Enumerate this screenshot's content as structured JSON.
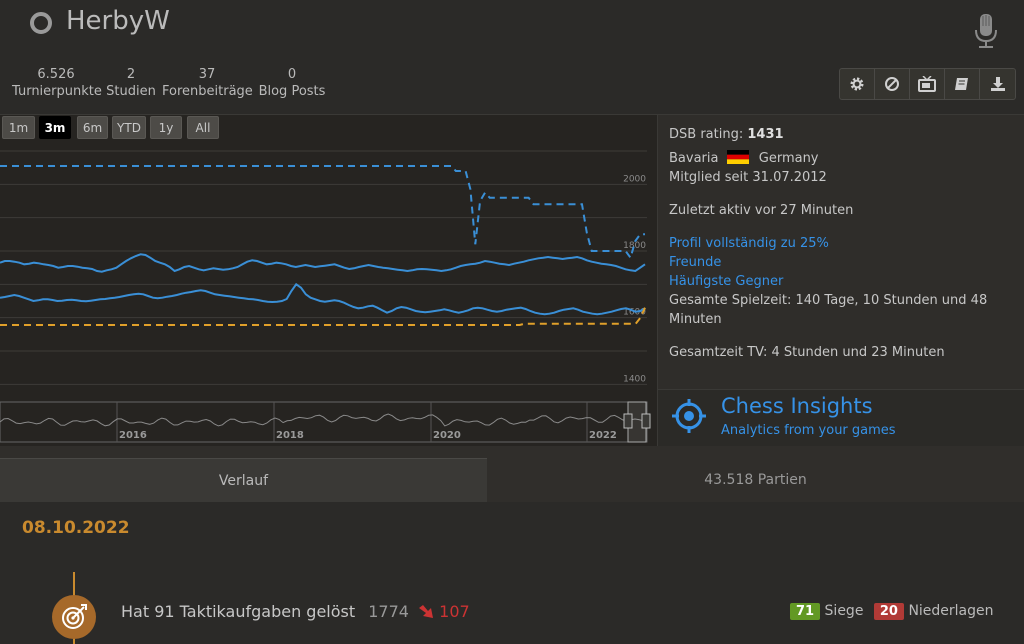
{
  "user": {
    "name": "HerbyW"
  },
  "stats": [
    {
      "value": "6.526",
      "label": "Turnierpunkte"
    },
    {
      "value": "2",
      "label": "Studien"
    },
    {
      "value": "37",
      "label": "Forenbeiträge"
    },
    {
      "value": "0",
      "label": "Blog Posts"
    }
  ],
  "actions": [
    "gear-icon",
    "block-icon",
    "tv-icon",
    "book-icon",
    "download-icon"
  ],
  "ranges": [
    "1m",
    "3m",
    "6m",
    "YTD",
    "1y",
    "All"
  ],
  "active_range": "3m",
  "chart_data": {
    "type": "line",
    "y_ticks": [
      "2000",
      "1800",
      "1600",
      "1400"
    ],
    "navigator_years": [
      "2016",
      "2018",
      "2020",
      "2022"
    ],
    "series": [
      {
        "style": "dashed",
        "color": "#3a8fd6",
        "values": [
          2055,
          2055,
          2055,
          2055,
          2055,
          2055,
          2055,
          2055,
          2055,
          2055,
          2055,
          2055,
          2055,
          2055,
          2055,
          2055,
          2055,
          2055,
          2055,
          2055,
          2055,
          2055,
          2055,
          2055,
          2055,
          2055,
          2055,
          2055,
          2055,
          2055,
          2055,
          2055,
          2055,
          2055,
          2055,
          2055,
          2055,
          2055,
          2055,
          2055,
          2055,
          2055,
          2055,
          2055,
          2055,
          2055,
          2055,
          2055,
          2055,
          2055,
          2055,
          2055,
          2055,
          2055,
          2055,
          2055,
          2055,
          2055,
          2055,
          2055,
          2055,
          2055,
          2055,
          2055,
          2055,
          2055,
          2055,
          2055,
          2055,
          2055,
          2055,
          2055,
          2055,
          2055,
          2055,
          2055,
          2055,
          2055,
          2055,
          2055,
          2055,
          2055,
          2055,
          2055,
          2055,
          2055,
          2055,
          2055,
          2055,
          2055,
          2055,
          2055,
          2055,
          2055,
          2040,
          2040,
          2040,
          1985,
          1820,
          1950,
          1975,
          1960,
          1960,
          1960,
          1960,
          1960,
          1960,
          1960,
          1960,
          1960,
          1940,
          1940,
          1940,
          1940,
          1940,
          1940,
          1940,
          1940,
          1940,
          1940,
          1940,
          1855,
          1800,
          1800,
          1800,
          1800,
          1800,
          1800,
          1800,
          1800,
          1780,
          1830,
          1850,
          1850
        ]
      },
      {
        "style": "solid",
        "color": "#3a8fd6",
        "values": [
          1765,
          1770,
          1770,
          1768,
          1765,
          1760,
          1762,
          1765,
          1763,
          1760,
          1758,
          1755,
          1750,
          1752,
          1755,
          1755,
          1753,
          1750,
          1748,
          1746,
          1740,
          1738,
          1742,
          1745,
          1750,
          1760,
          1770,
          1778,
          1785,
          1790,
          1788,
          1780,
          1770,
          1765,
          1760,
          1752,
          1740,
          1745,
          1752,
          1755,
          1750,
          1745,
          1742,
          1745,
          1748,
          1746,
          1744,
          1745,
          1748,
          1752,
          1760,
          1768,
          1772,
          1770,
          1765,
          1760,
          1762,
          1765,
          1763,
          1760,
          1755,
          1752,
          1755,
          1758,
          1755,
          1752,
          1754,
          1756,
          1758,
          1760,
          1755,
          1750,
          1746,
          1748,
          1752,
          1755,
          1758,
          1755,
          1752,
          1750,
          1748,
          1746,
          1744,
          1742,
          1740,
          1742,
          1745,
          1746,
          1745,
          1744,
          1742,
          1740,
          1742,
          1745,
          1750,
          1755,
          1758,
          1760,
          1762,
          1765,
          1770,
          1768,
          1765,
          1762,
          1760,
          1758,
          1762,
          1765,
          1768,
          1772,
          1775,
          1778,
          1780,
          1782,
          1780,
          1778,
          1776,
          1778,
          1780,
          1782,
          1778,
          1772,
          1768,
          1765,
          1762,
          1760,
          1758,
          1755,
          1750,
          1745,
          1742,
          1740,
          1750,
          1760
        ]
      },
      {
        "style": "solid",
        "color": "#3a8fd6",
        "values": [
          1660,
          1662,
          1665,
          1668,
          1665,
          1660,
          1655,
          1650,
          1652,
          1655,
          1655,
          1653,
          1650,
          1651,
          1653,
          1654,
          1652,
          1650,
          1649,
          1651,
          1653,
          1655,
          1656,
          1658,
          1660,
          1662,
          1665,
          1668,
          1670,
          1672,
          1670,
          1665,
          1660,
          1658,
          1660,
          1663,
          1665,
          1668,
          1672,
          1675,
          1677,
          1680,
          1682,
          1680,
          1675,
          1670,
          1668,
          1666,
          1664,
          1662,
          1660,
          1658,
          1656,
          1655,
          1653,
          1650,
          1648,
          1647,
          1648,
          1650,
          1656,
          1680,
          1700,
          1690,
          1670,
          1660,
          1655,
          1650,
          1648,
          1650,
          1652,
          1650,
          1645,
          1638,
          1632,
          1628,
          1630,
          1634,
          1636,
          1630,
          1622,
          1615,
          1620,
          1628,
          1632,
          1630,
          1625,
          1620,
          1618,
          1616,
          1618,
          1620,
          1622,
          1625,
          1622,
          1618,
          1615,
          1618,
          1622,
          1628,
          1630,
          1628,
          1624,
          1620,
          1618,
          1620,
          1624,
          1626,
          1628,
          1630,
          1626,
          1620,
          1615,
          1612,
          1610,
          1612,
          1615,
          1620,
          1624,
          1626,
          1628,
          1624,
          1618,
          1615,
          1612,
          1610,
          1612,
          1615,
          1618,
          1622,
          1626,
          1628,
          1624,
          1618,
          1620,
          1628
        ]
      },
      {
        "style": "dashed",
        "color": "#e0a02a",
        "values": [
          1578,
          1578,
          1578,
          1578,
          1578,
          1578,
          1578,
          1578,
          1578,
          1578,
          1578,
          1578,
          1578,
          1578,
          1578,
          1578,
          1578,
          1578,
          1578,
          1578,
          1578,
          1578,
          1578,
          1578,
          1578,
          1578,
          1578,
          1578,
          1578,
          1578,
          1578,
          1578,
          1578,
          1578,
          1578,
          1578,
          1578,
          1578,
          1578,
          1578,
          1578,
          1578,
          1578,
          1578,
          1578,
          1578,
          1578,
          1578,
          1578,
          1578,
          1578,
          1578,
          1578,
          1578,
          1578,
          1578,
          1578,
          1578,
          1578,
          1578,
          1578,
          1578,
          1578,
          1578,
          1578,
          1578,
          1578,
          1578,
          1578,
          1578,
          1578,
          1578,
          1578,
          1578,
          1578,
          1578,
          1578,
          1578,
          1578,
          1578,
          1578,
          1578,
          1578,
          1578,
          1578,
          1578,
          1578,
          1578,
          1578,
          1578,
          1578,
          1578,
          1578,
          1578,
          1578,
          1578,
          1578,
          1578,
          1578,
          1578,
          1578,
          1578,
          1578,
          1578,
          1578,
          1578,
          1578,
          1578,
          1578,
          1578,
          1578,
          1578,
          1578,
          1582,
          1582,
          1582,
          1582,
          1582,
          1582,
          1582,
          1582,
          1582,
          1582,
          1582,
          1582,
          1582,
          1582,
          1582,
          1582,
          1582,
          1582,
          1582,
          1582,
          1582,
          1582,
          1582,
          1582,
          1582,
          1600,
          1630
        ]
      }
    ]
  },
  "profile": {
    "dsb_label": "DSB rating:",
    "dsb_value": "1431",
    "region": "Bavaria",
    "country": "Germany",
    "member_since": "Mitglied seit 31.07.2012",
    "last_active": "Zuletzt aktiv vor 27 Minuten",
    "profile_complete": "Profil vollständig zu 25%",
    "friends": "Freunde",
    "frequent_opponents": "Häufigste Gegner",
    "playtime": "Gesamte Spielzeit: 140 Tage, 10 Stunden und 48 Minuten",
    "tv_time": "Gesamtzeit TV: 4 Stunden und 23 Minuten"
  },
  "insights": {
    "title": "Chess Insights",
    "subtitle": "Analytics from your games"
  },
  "tabs": {
    "activity": "Verlauf",
    "games": "43.518 Partien"
  },
  "feed": {
    "date": "08.10.2022",
    "puzzle_text": "Hat 91 Taktikaufgaben gelöst",
    "puzzle_rating": "1774",
    "puzzle_diff": "107",
    "wins": "71",
    "wins_label": "Siege",
    "losses": "20",
    "losses_label": "Niederlagen"
  }
}
